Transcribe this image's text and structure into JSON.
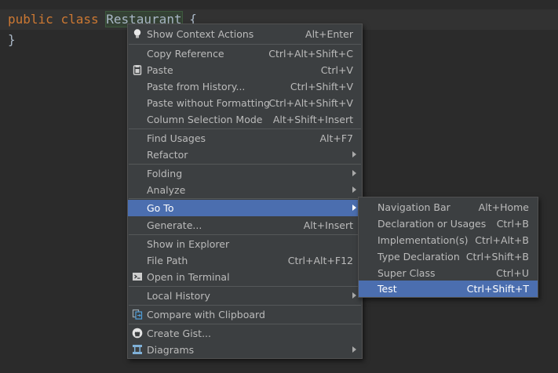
{
  "editor": {
    "line1": {
      "kw1": "public",
      "kw2": "class",
      "class_name": "Restaurant",
      "brace": "{"
    },
    "line2": "}"
  },
  "context_menu": {
    "items": [
      {
        "label": "Show Context Actions",
        "shortcut": "Alt+Enter",
        "icon": "lightbulb-icon"
      },
      {
        "label": "Copy Reference",
        "shortcut": "Ctrl+Alt+Shift+C"
      },
      {
        "label": "Paste",
        "shortcut": "Ctrl+V",
        "icon": "clipboard-icon"
      },
      {
        "label": "Paste from History...",
        "shortcut": "Ctrl+Shift+V"
      },
      {
        "label": "Paste without Formatting",
        "shortcut": "Ctrl+Alt+Shift+V"
      },
      {
        "label": "Column Selection Mode",
        "shortcut": "Alt+Shift+Insert"
      },
      {
        "label": "Find Usages",
        "shortcut": "Alt+F7"
      },
      {
        "label": "Refactor"
      },
      {
        "label": "Folding"
      },
      {
        "label": "Analyze"
      },
      {
        "label": "Go To",
        "selected": true
      },
      {
        "label": "Generate...",
        "shortcut": "Alt+Insert"
      },
      {
        "label": "Show in Explorer"
      },
      {
        "label": "File Path",
        "shortcut": "Ctrl+Alt+F12"
      },
      {
        "label": "Open in Terminal",
        "icon": "terminal-icon"
      },
      {
        "label": "Local History"
      },
      {
        "label": "Compare with Clipboard",
        "icon": "compare-icon"
      },
      {
        "label": "Create Gist...",
        "icon": "github-icon"
      },
      {
        "label": "Diagrams",
        "icon": "diagram-icon"
      }
    ]
  },
  "goto_submenu": {
    "items": [
      {
        "label": "Navigation Bar",
        "shortcut": "Alt+Home"
      },
      {
        "label": "Declaration or Usages",
        "shortcut": "Ctrl+B"
      },
      {
        "label": "Implementation(s)",
        "shortcut": "Ctrl+Alt+B"
      },
      {
        "label": "Type Declaration",
        "shortcut": "Ctrl+Shift+B"
      },
      {
        "label": "Super Class",
        "shortcut": "Ctrl+U"
      },
      {
        "label": "Test",
        "shortcut": "Ctrl+Shift+T",
        "selected": true
      }
    ]
  },
  "colors": {
    "menu_bg": "#3c3f41",
    "selection": "#4b6eaf",
    "editor_bg": "#2b2b2b",
    "keyword": "#cc7832"
  }
}
